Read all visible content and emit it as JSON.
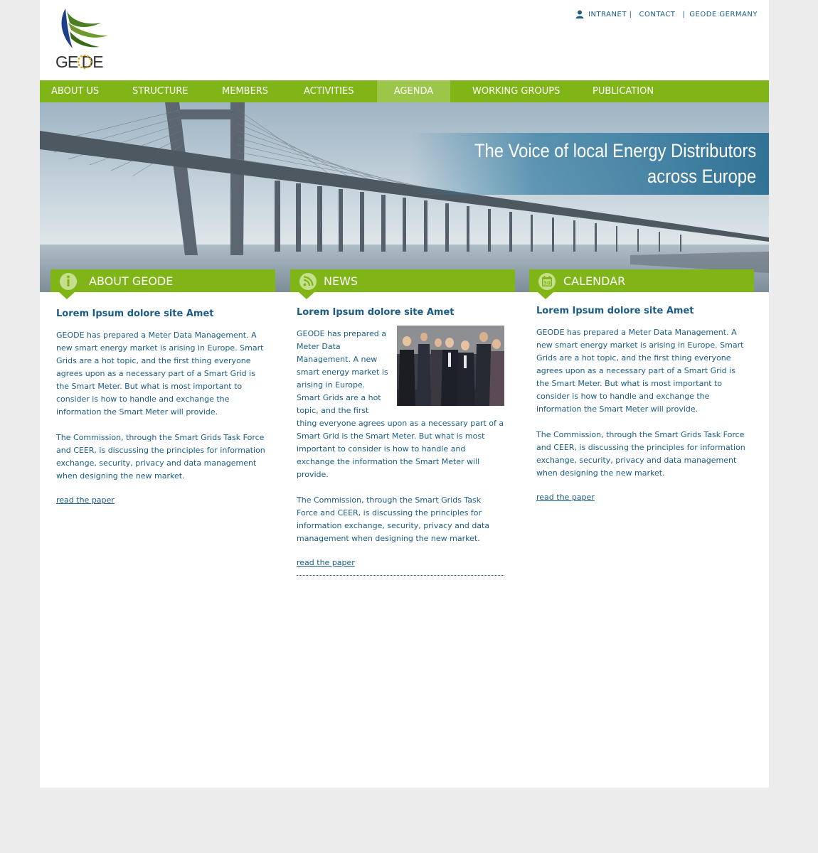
{
  "brand": {
    "logo_text": "GE DE"
  },
  "top_links": [
    "INTRANET |",
    "CONTACT",
    "|",
    "GEODE GERMANY"
  ],
  "nav": {
    "items": [
      "ABOUT US",
      "STRUCTURE",
      "MEMBERS",
      "ACTIVITIES",
      "AGENDA",
      "WORKING GROUPS",
      "PUBLICATION"
    ],
    "active": "AGENDA"
  },
  "hero": {
    "tagline_line1": "The Voice of local Energy Distributors",
    "tagline_line2": "across Europe"
  },
  "columns": [
    {
      "header": "ABOUT GEODE",
      "icon": "info-icon",
      "title": "Lorem Ipsum dolore site Amet",
      "para1": "GEODE has prepared a Meter Data Management. A new smart energy market is arising in Europe. Smart Grids are a hot topic, and the first thing everyone agrees upon as a necessary part of a Smart Grid is the Smart Meter. But what is most important to consider is how to handle and exchange the information the Smart Meter will provide.",
      "para2": "The Commission, through the Smart Grids Task Force and CEER, is discussing the principles for information exchange, security, privacy and data management when designing the new market.",
      "link": "read the paper"
    },
    {
      "header": "NEWS",
      "icon": "rss-icon",
      "title": "Lorem Ipsum dolore site Amet",
      "para1": "GEODE has prepared a Meter Data Management. A new smart energy market is arising in Europe. Smart Grids are a hot topic, and the first thing everyone agrees upon as a necessary part of a Smart Grid is the Smart Meter. But what is most important to consider is how to handle and exchange the information the Smart Meter will provide.",
      "para2": "The Commission, through the Smart Grids Task Force and CEER, is discussing the principles for information exchange, security, privacy and data management when designing the new market.",
      "link": "read the paper"
    },
    {
      "header": "CALENDAR",
      "icon": "calendar-icon",
      "icon_text": "30",
      "title": "Lorem Ipsum dolore site Amet",
      "para1": "GEODE has prepared a Meter Data Management. A new smart energy market is arising in Europe. Smart Grids are a hot topic, and the first thing everyone agrees upon as a necessary part of a Smart Grid is the Smart Meter. But what is most important to consider is how to handle and exchange the information the Smart Meter will provide.",
      "para2": "The Commission, through the Smart Grids Task Force and CEER, is discussing the principles for information exchange, security, privacy and data management when designing the new market.",
      "link": "read the paper"
    }
  ],
  "colors": {
    "green": "#7fb516",
    "nav_active": "#9cc64a",
    "text_blue": "#1a5c86",
    "background": "#ececec"
  }
}
